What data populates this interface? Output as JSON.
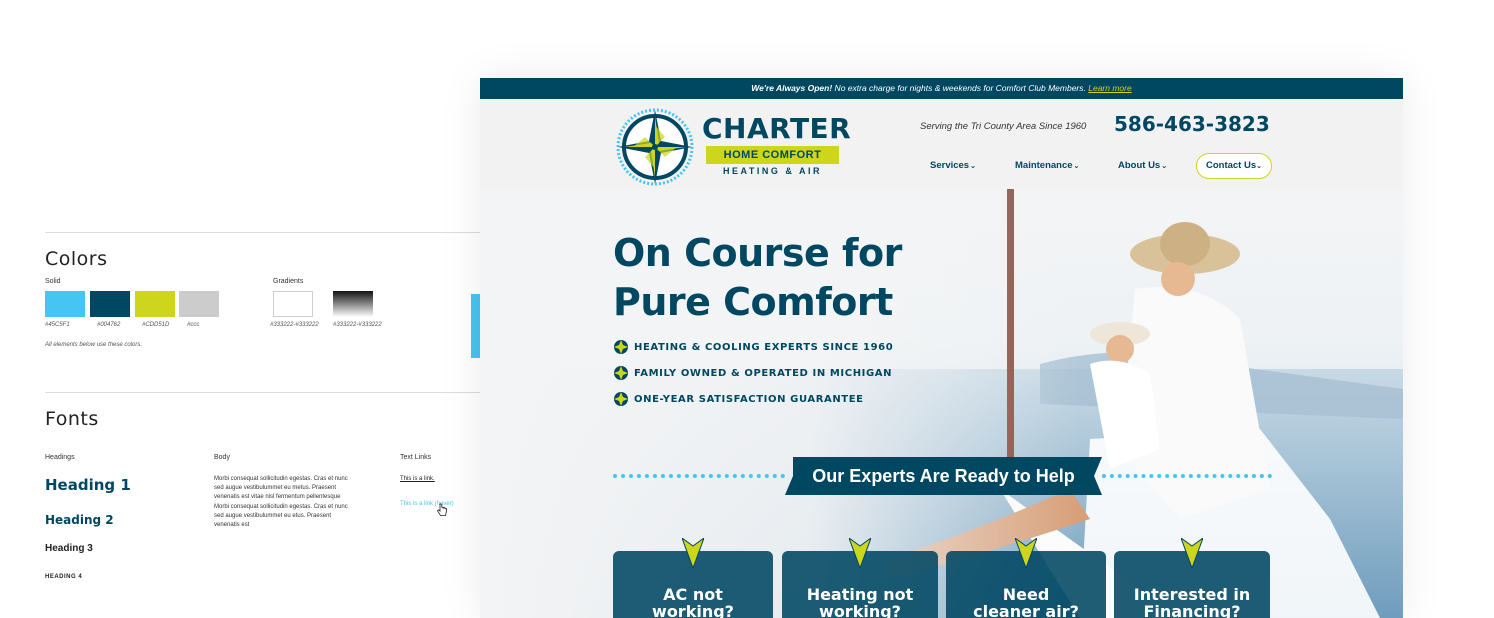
{
  "guide": {
    "colors_title": "Colors",
    "solid_label": "Solid",
    "gradients_label": "Gradients",
    "swatches": [
      {
        "hex": "#45c5f1",
        "code": "#45C5F1"
      },
      {
        "hex": "#004762",
        "code": "#004762"
      },
      {
        "hex": "#cdd51d",
        "code": "#CDD51D"
      },
      {
        "hex": "#cccccc",
        "code": "#ccc"
      }
    ],
    "gradients": [
      {
        "code": "#333222-#333222"
      },
      {
        "code": "#333222-#333222"
      }
    ],
    "colors_note": "All elements below use these colors.",
    "fonts_title": "Fonts",
    "headings_label": "Headings",
    "body_label": "Body",
    "links_label": "Text Links",
    "heading1": "Heading 1",
    "heading2": "Heading 2",
    "heading3": "Heading 3",
    "heading4": "HEADING 4",
    "body_text": "Morbi consequat sollicitudin egestas. Cras et nunc sed augue vestibulummet eu metus. Praesent venenatis est vitae nisl fermentum pellentesque Morbi consequat sollicitudin egestas. Cras et nunc sed augue vestibulummet eu etus. Praesent venenatis est",
    "link_text": "This is a link.",
    "link_hover_text": "This is a link (hover)"
  },
  "site": {
    "topbar": {
      "bold": "We're Always Open!",
      "text": " No extra charge for nights & weekends for Comfort Club Members. ",
      "link": "Learn more"
    },
    "brand": {
      "name": "CHARTER",
      "line2": "HOME COMFORT",
      "line3": "HEATING & AIR"
    },
    "serving": "Serving the Tri County Area Since 1960",
    "phone": "586-463-3823",
    "nav": [
      "Services",
      "Maintenance",
      "About Us"
    ],
    "contact": "Contact Us",
    "hero": {
      "title_line1": "On Course for",
      "title_line2": "Pure Comfort",
      "bullets": [
        "HEATING & COOLING EXPERTS SINCE 1960",
        "FAMILY OWNED & OPERATED IN MICHIGAN",
        "ONE-YEAR SATISFACTION GUARANTEE"
      ],
      "banner": "Our Experts Are Ready to Help",
      "cards": [
        {
          "line1": "AC not",
          "line2": "working?"
        },
        {
          "line1": "Heating not",
          "line2": "working?"
        },
        {
          "line1": "Need",
          "line2": "cleaner air?"
        },
        {
          "line1": "Interested in",
          "line2": "Financing?"
        }
      ]
    }
  },
  "colors": {
    "accent_blue": "#45c5f1",
    "brand_navy": "#004762",
    "brand_lime": "#cdd51d",
    "gray": "#cccccc"
  }
}
